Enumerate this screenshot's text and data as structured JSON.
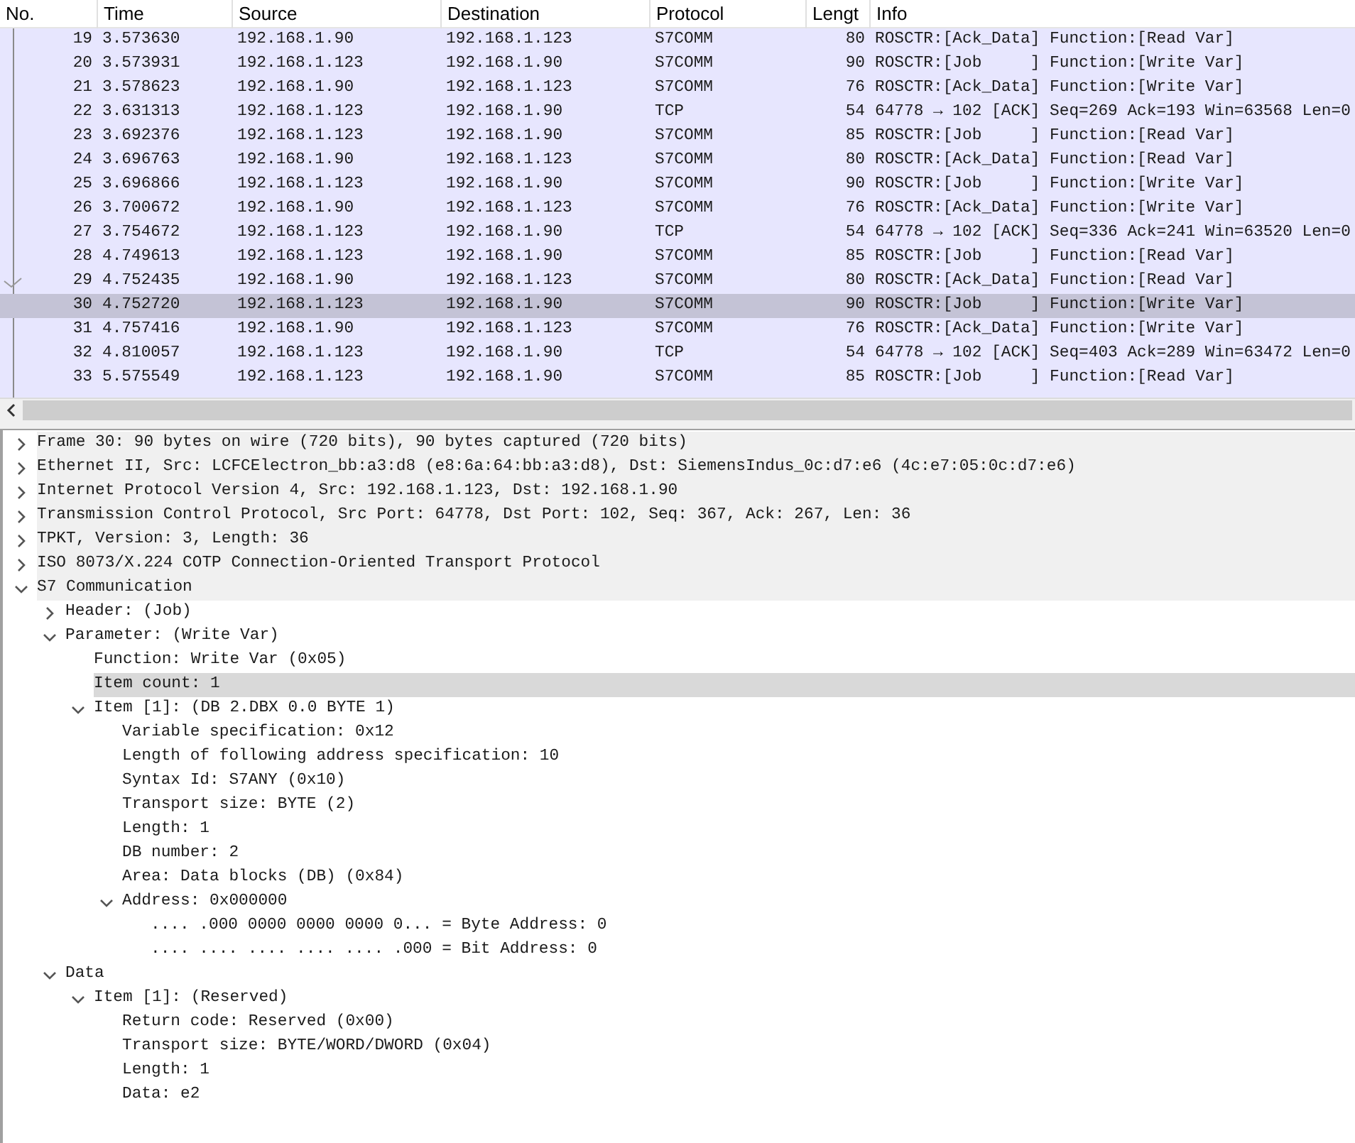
{
  "packet_list": {
    "columns": [
      "No.",
      "Time",
      "Source",
      "Destination",
      "Protocol",
      "Lengt",
      "Info"
    ],
    "rows": [
      {
        "no": "19",
        "time": "3.573630",
        "source": "192.168.1.90",
        "destination": "192.168.1.123",
        "protocol": "S7COMM",
        "length": "80",
        "info": "ROSCTR:[Ack_Data] Function:[Read Var]",
        "selected": false,
        "related": false
      },
      {
        "no": "20",
        "time": "3.573931",
        "source": "192.168.1.123",
        "destination": "192.168.1.90",
        "protocol": "S7COMM",
        "length": "90",
        "info": "ROSCTR:[Job     ] Function:[Write Var]",
        "selected": false,
        "related": false
      },
      {
        "no": "21",
        "time": "3.578623",
        "source": "192.168.1.90",
        "destination": "192.168.1.123",
        "protocol": "S7COMM",
        "length": "76",
        "info": "ROSCTR:[Ack_Data] Function:[Write Var]",
        "selected": false,
        "related": false
      },
      {
        "no": "22",
        "time": "3.631313",
        "source": "192.168.1.123",
        "destination": "192.168.1.90",
        "protocol": "TCP",
        "length": "54",
        "info": "64778 → 102 [ACK] Seq=269 Ack=193 Win=63568 Len=0",
        "selected": false,
        "related": false
      },
      {
        "no": "23",
        "time": "3.692376",
        "source": "192.168.1.123",
        "destination": "192.168.1.90",
        "protocol": "S7COMM",
        "length": "85",
        "info": "ROSCTR:[Job     ] Function:[Read Var]",
        "selected": false,
        "related": false
      },
      {
        "no": "24",
        "time": "3.696763",
        "source": "192.168.1.90",
        "destination": "192.168.1.123",
        "protocol": "S7COMM",
        "length": "80",
        "info": "ROSCTR:[Ack_Data] Function:[Read Var]",
        "selected": false,
        "related": false
      },
      {
        "no": "25",
        "time": "3.696866",
        "source": "192.168.1.123",
        "destination": "192.168.1.90",
        "protocol": "S7COMM",
        "length": "90",
        "info": "ROSCTR:[Job     ] Function:[Write Var]",
        "selected": false,
        "related": false
      },
      {
        "no": "26",
        "time": "3.700672",
        "source": "192.168.1.90",
        "destination": "192.168.1.123",
        "protocol": "S7COMM",
        "length": "76",
        "info": "ROSCTR:[Ack_Data] Function:[Write Var]",
        "selected": false,
        "related": false
      },
      {
        "no": "27",
        "time": "3.754672",
        "source": "192.168.1.123",
        "destination": "192.168.1.90",
        "protocol": "TCP",
        "length": "54",
        "info": "64778 → 102 [ACK] Seq=336 Ack=241 Win=63520 Len=0",
        "selected": false,
        "related": false
      },
      {
        "no": "28",
        "time": "4.749613",
        "source": "192.168.1.123",
        "destination": "192.168.1.90",
        "protocol": "S7COMM",
        "length": "85",
        "info": "ROSCTR:[Job     ] Function:[Read Var]",
        "selected": false,
        "related": false
      },
      {
        "no": "29",
        "time": "4.752435",
        "source": "192.168.1.90",
        "destination": "192.168.1.123",
        "protocol": "S7COMM",
        "length": "80",
        "info": "ROSCTR:[Ack_Data] Function:[Read Var]",
        "selected": false,
        "related": true
      },
      {
        "no": "30",
        "time": "4.752720",
        "source": "192.168.1.123",
        "destination": "192.168.1.90",
        "protocol": "S7COMM",
        "length": "90",
        "info": "ROSCTR:[Job     ] Function:[Write Var]",
        "selected": true,
        "related": false
      },
      {
        "no": "31",
        "time": "4.757416",
        "source": "192.168.1.90",
        "destination": "192.168.1.123",
        "protocol": "S7COMM",
        "length": "76",
        "info": "ROSCTR:[Ack_Data] Function:[Write Var]",
        "selected": false,
        "related": false
      },
      {
        "no": "32",
        "time": "4.810057",
        "source": "192.168.1.123",
        "destination": "192.168.1.90",
        "protocol": "TCP",
        "length": "54",
        "info": "64778 → 102 [ACK] Seq=403 Ack=289 Win=63472 Len=0",
        "selected": false,
        "related": false
      },
      {
        "no": "33",
        "time": "5.575549",
        "source": "192.168.1.123",
        "destination": "192.168.1.90",
        "protocol": "S7COMM",
        "length": "85",
        "info": "ROSCTR:[Job     ] Function:[Read Var]",
        "selected": false,
        "related": false
      }
    ]
  },
  "packet_details": [
    {
      "text": "Frame 30: 90 bytes on wire (720 bits), 90 bytes captured (720 bits)",
      "expanded": false,
      "selected": false
    },
    {
      "text": "Ethernet II, Src: LCFCElectron_bb:a3:d8 (e8:6a:64:bb:a3:d8), Dst: SiemensIndus_0c:d7:e6 (4c:e7:05:0c:d7:e6)",
      "expanded": false,
      "selected": false
    },
    {
      "text": "Internet Protocol Version 4, Src: 192.168.1.123, Dst: 192.168.1.90",
      "expanded": false,
      "selected": false
    },
    {
      "text": "Transmission Control Protocol, Src Port: 64778, Dst Port: 102, Seq: 367, Ack: 267, Len: 36",
      "expanded": false,
      "selected": false
    },
    {
      "text": "TPKT, Version: 3, Length: 36",
      "expanded": false,
      "selected": false
    },
    {
      "text": "ISO 8073/X.224 COTP Connection-Oriented Transport Protocol",
      "expanded": false,
      "selected": false
    },
    {
      "text": "S7 Communication",
      "expanded": true,
      "selected": false,
      "children": [
        {
          "text": "Header: (Job)",
          "expanded": false,
          "selected": false
        },
        {
          "text": "Parameter: (Write Var)",
          "expanded": true,
          "selected": false,
          "children": [
            {
              "text": "Function: Write Var (0x05)",
              "selected": false
            },
            {
              "text": "Item count: 1",
              "selected": true
            },
            {
              "text": "Item [1]: (DB 2.DBX 0.0 BYTE 1)",
              "expanded": true,
              "selected": false,
              "children": [
                {
                  "text": "Variable specification: 0x12",
                  "selected": false
                },
                {
                  "text": "Length of following address specification: 10",
                  "selected": false
                },
                {
                  "text": "Syntax Id: S7ANY (0x10)",
                  "selected": false
                },
                {
                  "text": "Transport size: BYTE (2)",
                  "selected": false
                },
                {
                  "text": "Length: 1",
                  "selected": false
                },
                {
                  "text": "DB number: 2",
                  "selected": false
                },
                {
                  "text": "Area: Data blocks (DB) (0x84)",
                  "selected": false
                },
                {
                  "text": "Address: 0x000000",
                  "expanded": true,
                  "selected": false,
                  "children": [
                    {
                      "text": ".... .000 0000 0000 0000 0... = Byte Address: 0",
                      "selected": false
                    },
                    {
                      "text": ".... .... .... .... .... .000 = Bit Address: 0",
                      "selected": false
                    }
                  ]
                }
              ]
            }
          ]
        },
        {
          "text": "Data",
          "expanded": true,
          "selected": false,
          "children": [
            {
              "text": "Item [1]: (Reserved)",
              "expanded": true,
              "selected": false,
              "children": [
                {
                  "text": "Return code: Reserved (0x00)",
                  "selected": false
                },
                {
                  "text": "Transport size: BYTE/WORD/DWORD (0x04)",
                  "selected": false
                },
                {
                  "text": "Length: 1",
                  "selected": false
                },
                {
                  "text": "Data: e2",
                  "selected": false
                }
              ]
            }
          ]
        }
      ]
    }
  ]
}
